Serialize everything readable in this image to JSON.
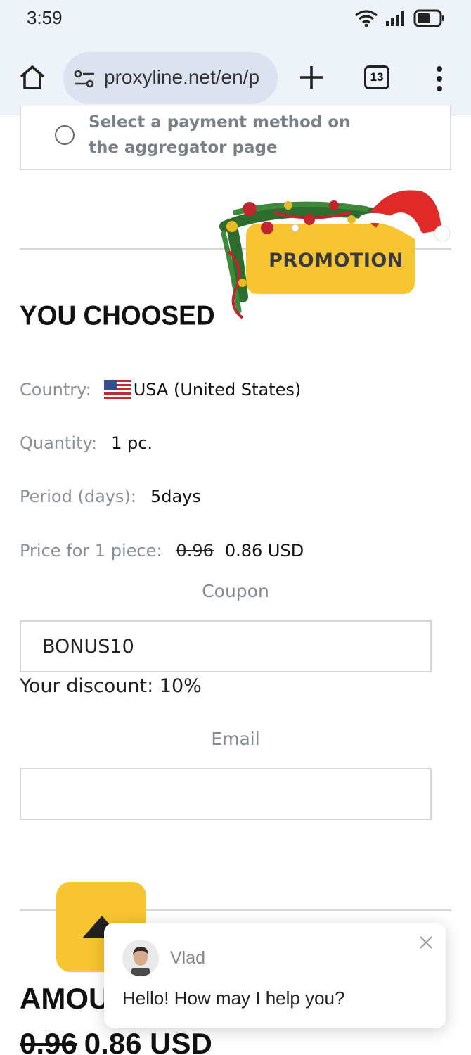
{
  "status": {
    "time": "3:59",
    "icons": [
      "wifi-icon",
      "signal-icon",
      "battery-icon"
    ]
  },
  "browser": {
    "url": "proxyline.net/en/p",
    "tab_count": "13",
    "icons": [
      "home-icon",
      "site-settings-icon",
      "new-tab-icon",
      "tabs-icon",
      "more-menu-icon"
    ]
  },
  "payment": {
    "option_label": "Select a payment method on the aggregator page"
  },
  "promo": {
    "label": "PROMOTION"
  },
  "order": {
    "heading": "YOU CHOOSED",
    "country_label": "Country:",
    "country_value": "USA (United States)",
    "quantity_label": "Quantity:",
    "quantity_value": "1 pc.",
    "period_label": "Period (days):",
    "period_value": "5days",
    "price_label": "Price for 1 piece:",
    "price_old": "0.96",
    "price_new": "0.86 USD"
  },
  "coupon": {
    "label": "Coupon",
    "value": "BONUS10",
    "discount_text": "Your discount: 10%"
  },
  "email": {
    "label": "Email",
    "value": ""
  },
  "amount": {
    "heading": "AMOUNT",
    "old": "0.96",
    "new": "0.86 USD"
  },
  "chat": {
    "agent_name": "Vlad",
    "message": "Hello! How may I help you?"
  },
  "colors": {
    "accent_yellow": "#f7c531",
    "toolbar_bg": "#eef2f9",
    "label_gray": "#8a8f96"
  }
}
